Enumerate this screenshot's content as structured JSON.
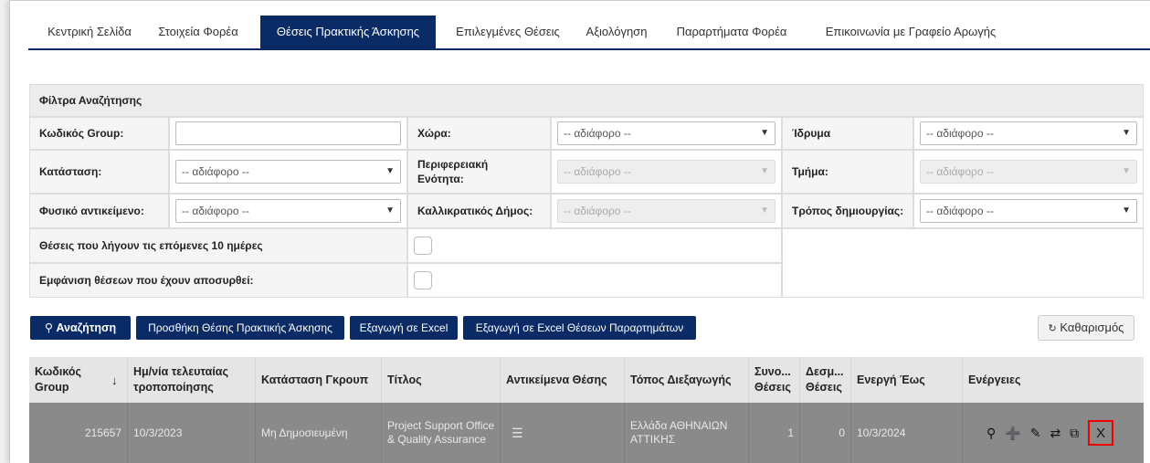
{
  "tabs": [
    "Κεντρική Σελίδα",
    "Στοιχεία Φορέα",
    "Θέσεις Πρακτικής Άσκησης",
    "Επιλεγμένες Θέσεις",
    "Αξιολόγηση",
    "Παραρτήματα Φορέα",
    "Επικοινωνία με Γραφείο Αρωγής"
  ],
  "filters": {
    "title": "Φίλτρα Αναζήτησης",
    "group_code_label": "Κωδικός Group:",
    "country_label": "Χώρα:",
    "country_value": "-- αδιάφορο --",
    "institution_label": "Ίδρυμα",
    "institution_value": "-- αδιάφορο --",
    "status_label": "Κατάσταση:",
    "status_value": "-- αδιάφορο --",
    "region_label": "Περιφερειακή Ενότητα:",
    "region_value": "-- αδιάφορο --",
    "department_label": "Τμήμα:",
    "department_value": "-- αδιάφορο --",
    "subject_label": "Φυσικό αντικείμενο:",
    "subject_value": "-- αδιάφορο --",
    "municipality_label": "Καλλικρατικός Δήμος:",
    "municipality_value": "-- αδιάφορο --",
    "creation_label": "Τρόπος δημιουργίας:",
    "creation_value": "-- αδιάφορο --",
    "expiring_label": "Θέσεις που λήγουν τις επόμενες 10 ημέρες",
    "withdrawn_label": "Εμφάνιση θέσεων που έχουν αποσυρθεί:"
  },
  "buttons": {
    "search": "Αναζήτηση",
    "add": "Προσθήκη Θέσης Πρακτικής Άσκησης",
    "export": "Εξαγωγή σε Excel",
    "export_annex": "Εξαγωγή σε Excel Θέσεων Παραρτημάτων",
    "reset": "Καθαρισμός"
  },
  "table": {
    "headers": {
      "code": "Κωδικός Group",
      "modified": "Ημ/νία τελευταίας τροποποίησης",
      "group_status": "Κατάσταση Γκρουπ",
      "title": "Τίτλος",
      "subjects": "Αντικείμενα Θέσης",
      "location": "Τόπος Διεξαγωγής",
      "total": "Συνο... Θέσεις",
      "reserved": "Δεσμ... Θέσεις",
      "active_until": "Ενεργή Έως",
      "actions": "Ενέργειες"
    },
    "rows": [
      {
        "code": "215657",
        "modified": "10/3/2023",
        "group_status": "Μη Δημοσιευμένη",
        "title": "Project Support Office & Quality Assurance",
        "location": "Ελλάδα ΑΘΗΝΑΙΩΝ ΑΤΤΙΚΗΣ",
        "total": "1",
        "reserved": "0",
        "active_until": "10/3/2024"
      }
    ]
  },
  "icons": [
    "search-icon",
    "plus-circle-icon",
    "edit-icon",
    "repeat-icon",
    "copy-icon",
    "close-icon",
    "list-icon",
    "sort-down-icon",
    "refresh-icon"
  ],
  "colors": {
    "primary": "#0b2b66",
    "highlight": "#e00000",
    "row_selected": "#8a8a8a"
  }
}
